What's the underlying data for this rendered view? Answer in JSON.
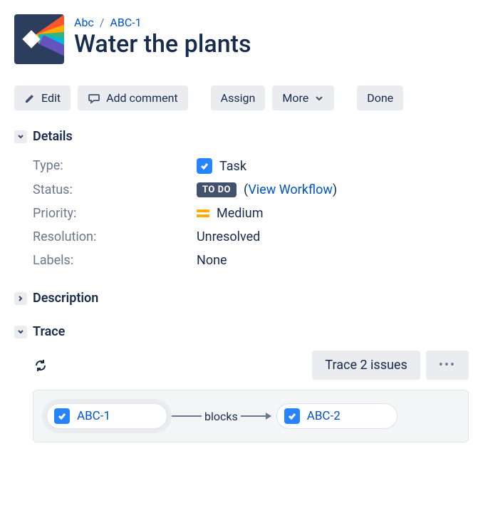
{
  "breadcrumb": {
    "project": "Abc",
    "issue_key": "ABC-1"
  },
  "issue_title": "Water the plants",
  "toolbar": {
    "edit": "Edit",
    "add_comment": "Add comment",
    "assign": "Assign",
    "more": "More",
    "done": "Done"
  },
  "sections": {
    "details": "Details",
    "description": "Description",
    "trace": "Trace"
  },
  "details": {
    "labels": {
      "type": "Type:",
      "status": "Status:",
      "priority": "Priority:",
      "resolution": "Resolution:",
      "labels": "Labels:"
    },
    "type": "Task",
    "status": "TO DO",
    "workflow_link": "View Workflow",
    "paren_open": "(",
    "paren_close": ")",
    "priority": "Medium",
    "resolution": "Unresolved",
    "labels_value": "None"
  },
  "trace": {
    "button": "Trace 2 issues",
    "node1": "ABC-1",
    "relation": "blocks",
    "node2": "ABC-2"
  }
}
